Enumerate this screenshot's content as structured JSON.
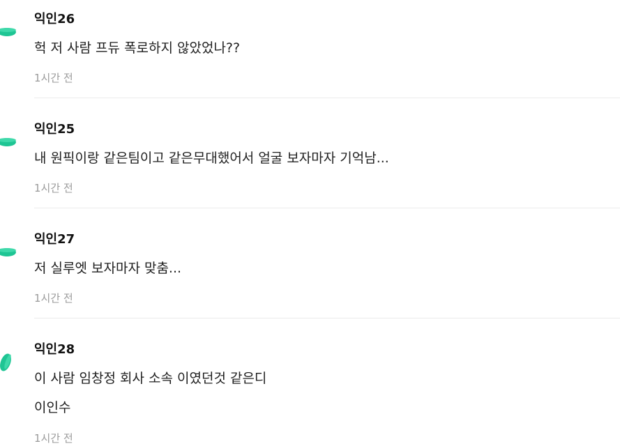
{
  "comments": [
    {
      "author": "익인26",
      "lines": [
        "헉 저 사람 프듀 폭로하지 않았었나??"
      ],
      "time": "1시간 전"
    },
    {
      "author": "익인25",
      "lines": [
        "내 원픽이랑 같은팀이고 같은무대했어서 얼굴 보자마자 기억남..."
      ],
      "time": "1시간 전"
    },
    {
      "author": "익인27",
      "lines": [
        "저 실루엣 보자마자 맞춤..."
      ],
      "time": "1시간 전"
    },
    {
      "author": "익인28",
      "lines": [
        "이 사람 임창정 회사 소속 이였던것 같은디",
        "이인수"
      ],
      "time": "1시간 전"
    }
  ],
  "colors": {
    "avatar_green": "#1fc594",
    "avatar_green_dark": "#17a87d",
    "time_gray": "#9a9a9a",
    "divider": "#ebebeb"
  }
}
